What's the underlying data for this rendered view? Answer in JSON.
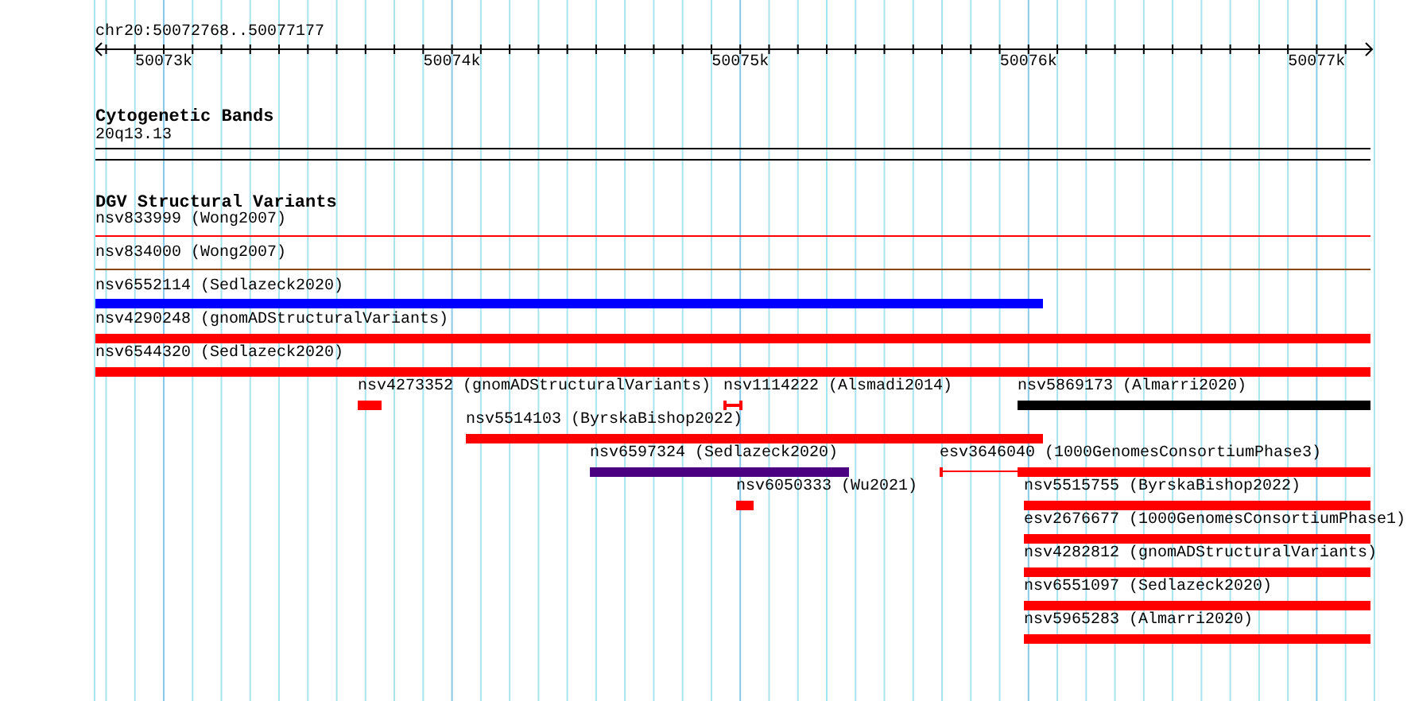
{
  "ruler": {
    "position": "chr20:50072768..50077177",
    "ticks": [
      "50073k",
      "50074k",
      "50075k",
      "50076k",
      "50077k"
    ]
  },
  "tracks": [
    {
      "title": "Cytogenetic Bands",
      "band": "20q13.13"
    },
    {
      "title": "DGV Structural Variants",
      "features": [
        {
          "label": "nsv833999 (Wong2007)",
          "kind": "line",
          "color": "#ff0000"
        },
        {
          "label": "nsv834000 (Wong2007)",
          "kind": "line",
          "color": "#8b4513"
        },
        {
          "label": "nsv6552114 (Sedlazeck2020)",
          "kind": "bar",
          "color": "#0000ff"
        },
        {
          "label": "nsv4290248 (gnomADStructuralVariants)",
          "kind": "bar",
          "color": "#ff0000"
        },
        {
          "label": "nsv6544320 (Sedlazeck2020)",
          "kind": "bar",
          "color": "#ff0000"
        },
        {
          "label": "nsv4273352 (gnomADStructuralVariants)",
          "kind": "bar",
          "color": "#ff0000"
        },
        {
          "label": "nsv1114222 (Alsmadi2014)",
          "kind": "interval",
          "color": "#ff0000"
        },
        {
          "label": "nsv5869173 (Almarri2020)",
          "kind": "bar",
          "color": "#000000"
        },
        {
          "label": "nsv5514103 (ByrskaBishop2022)",
          "kind": "bar",
          "color": "#ff0000"
        },
        {
          "label": "nsv6597324 (Sedlazeck2020)",
          "kind": "bar",
          "color": "#4b0082"
        },
        {
          "label": "esv3646040 (1000GenomesConsortiumPhase3)",
          "kind": "split",
          "color": "#ff0000"
        },
        {
          "label": "nsv6050333 (Wu2021)",
          "kind": "bar",
          "color": "#ff0000"
        },
        {
          "label": "nsv5515755 (ByrskaBishop2022)",
          "kind": "bar",
          "color": "#ff0000"
        },
        {
          "label": "esv2676677 (1000GenomesConsortiumPhase1)",
          "kind": "bar",
          "color": "#ff0000"
        },
        {
          "label": "nsv4282812 (gnomADStructuralVariants)",
          "kind": "bar",
          "color": "#ff0000"
        },
        {
          "label": "nsv6551097 (Sedlazeck2020)",
          "kind": "bar",
          "color": "#ff0000"
        },
        {
          "label": "nsv5965283 (Almarri2020)",
          "kind": "bar",
          "color": "#ff0000"
        }
      ]
    }
  ]
}
